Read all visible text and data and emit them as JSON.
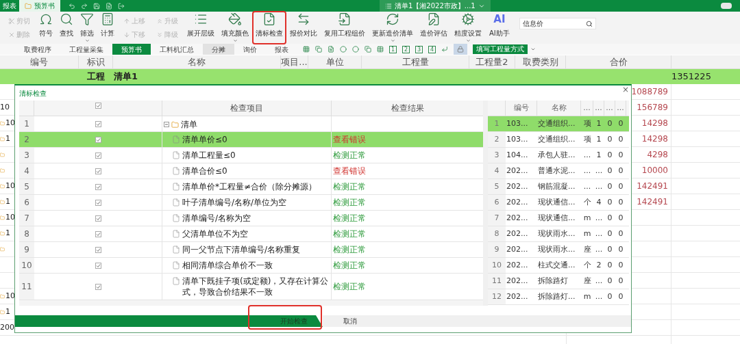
{
  "title_bar": {
    "tabs": [
      {
        "label": "报表",
        "selected": false
      },
      {
        "label": "预算书",
        "selected": true
      }
    ],
    "document": "清单1【湘2022市政】...1"
  },
  "toolbar": [
    {
      "kind": "stack",
      "items": [
        {
          "label": "剪切",
          "disabled": true
        },
        {
          "label": "删除",
          "disabled": true
        }
      ]
    },
    {
      "kind": "large",
      "label": "符号",
      "caret": false,
      "highlighted": false
    },
    {
      "kind": "large",
      "label": "查找",
      "caret": false,
      "highlighted": false
    },
    {
      "kind": "large",
      "label": "筛选",
      "caret": true,
      "highlighted": false
    },
    {
      "kind": "large",
      "label": "计算",
      "caret": false,
      "highlighted": false
    },
    {
      "kind": "stack",
      "items": [
        {
          "label": "上移",
          "disabled": true
        },
        {
          "label": "下移",
          "disabled": true
        }
      ]
    },
    {
      "kind": "stack",
      "items": [
        {
          "label": "升级",
          "disabled": true
        },
        {
          "label": "降级",
          "disabled": true
        }
      ]
    },
    {
      "kind": "large",
      "label": "展开层级",
      "caret": false,
      "highlighted": false
    },
    {
      "kind": "large",
      "label": "填充颜色",
      "caret": true,
      "highlighted": false
    },
    {
      "kind": "large",
      "label": "清标检查",
      "caret": false,
      "highlighted": true
    },
    {
      "kind": "large",
      "label": "报价对比",
      "caret": false,
      "highlighted": false
    },
    {
      "kind": "large",
      "label": "复用工程组价",
      "caret": false,
      "highlighted": false
    },
    {
      "kind": "large",
      "label": "更新造价清单",
      "caret": true,
      "highlighted": false
    },
    {
      "kind": "large",
      "label": "造价评估",
      "caret": false,
      "highlighted": false
    },
    {
      "kind": "large",
      "label": "精度设置",
      "caret": true,
      "highlighted": false
    },
    {
      "kind": "ai",
      "badge": "AI",
      "label": "AI助手"
    }
  ],
  "search": {
    "value": "信息价"
  },
  "view_tabs": [
    {
      "label": "取费程序",
      "selected": false,
      "hovered": false
    },
    {
      "label": "工程量采集",
      "selected": false,
      "hovered": false
    },
    {
      "label": "预算书",
      "selected": true,
      "hovered": false
    },
    {
      "label": "工料机汇总",
      "selected": false,
      "hovered": false
    },
    {
      "label": "分摊",
      "selected": false,
      "hovered": true
    },
    {
      "label": "询价",
      "selected": false,
      "hovered": false
    },
    {
      "label": "报表",
      "selected": false,
      "hovered": false
    }
  ],
  "level_buttons": [
    "1",
    "2",
    "3",
    "4"
  ],
  "mode_button": "填写工程量方式",
  "grid": {
    "columns": [
      "编号",
      "标识",
      "名称",
      "项目...",
      "单位",
      "工程量",
      "工程量2",
      "取费类别",
      "合价"
    ],
    "top_row": {
      "type": "工程",
      "name": "清单1",
      "total": "1351225"
    },
    "left_stubs": [
      {
        "folder": false
      },
      {
        "text": "10",
        "folder": false
      },
      {
        "text": "10",
        "folder": true
      },
      {
        "text": "1",
        "folder": true
      },
      {
        "folder": true
      },
      {
        "folder": true
      },
      {
        "text": "10",
        "folder": true
      },
      {
        "text": "1",
        "folder": true
      },
      {
        "text": "10",
        "folder": true
      },
      {
        "text": "1",
        "folder": true
      },
      {
        "folder": true
      },
      {
        "folder": false
      },
      {
        "folder": false
      },
      {
        "text": "10",
        "folder": true
      },
      {
        "text": "1",
        "folder": true
      },
      {
        "text": "200",
        "folder": false
      }
    ],
    "totals": [
      "1088789",
      "156789",
      "14298",
      "14298",
      "4298",
      "10000",
      "142491",
      "142491"
    ]
  },
  "dialog": {
    "title": "清标检查",
    "close": "×",
    "columns": [
      "检查项目",
      "检查结果"
    ],
    "header_checked": true,
    "checks": [
      {
        "num": "1",
        "checked": true,
        "label": "清单",
        "expanded": true,
        "selected": false,
        "children": [
          {
            "num": "2",
            "checked": true,
            "label": "清单单价≤0",
            "kind": "error",
            "result": "查看错误",
            "selected": true
          },
          {
            "num": "3",
            "checked": true,
            "label": "清单工程量≤0",
            "kind": "ok",
            "result": "检测正常",
            "selected": false
          },
          {
            "num": "4",
            "checked": true,
            "label": "清单合价≤0",
            "kind": "error",
            "result": "查看错误",
            "selected": false
          },
          {
            "num": "5",
            "checked": true,
            "label": "清单单价*工程量≠合价（除分摊源）",
            "kind": "ok",
            "result": "检测正常",
            "selected": false
          },
          {
            "num": "6",
            "checked": true,
            "label": "叶子清单编号/名称/单位为空",
            "kind": "ok",
            "result": "检测正常",
            "selected": false
          },
          {
            "num": "7",
            "checked": true,
            "label": "清单编号/名称为空",
            "kind": "ok",
            "result": "检测正常",
            "selected": false
          },
          {
            "num": "8",
            "checked": true,
            "label": "父清单单位不为空",
            "kind": "ok",
            "result": "检测正常",
            "selected": false
          },
          {
            "num": "9",
            "checked": true,
            "label": "同一父节点下清单编号/名称重复",
            "kind": "ok",
            "result": "检测正常",
            "selected": false
          },
          {
            "num": "10",
            "checked": true,
            "label": "相同清单综合单价不一致",
            "kind": "ok",
            "result": "检测正常",
            "selected": false
          },
          {
            "num": "11",
            "checked": true,
            "label": "清单下既挂子项(或定额)，又存在计算公式，导致合价结果不一致",
            "kind": "ok",
            "result": "检测正常",
            "selected": false
          }
        ]
      }
    ],
    "detail": {
      "columns": [
        "编号",
        "名称",
        "...",
        "...",
        "...",
        "..."
      ],
      "rows": [
        {
          "num": "1",
          "cells": [
            "103...",
            "交通组织...",
            "项",
            "1",
            "0",
            "0"
          ],
          "selected": true
        },
        {
          "num": "2",
          "cells": [
            "103...",
            "交通组织...",
            "项",
            "1",
            "0",
            "0"
          ],
          "selected": false
        },
        {
          "num": "3",
          "cells": [
            "104...",
            "承包人驻...",
            "...",
            "1",
            "0",
            "0"
          ],
          "selected": false
        },
        {
          "num": "4",
          "cells": [
            "202...",
            "普通水泥...",
            "...",
            "...",
            "0",
            "0"
          ],
          "selected": false
        },
        {
          "num": "5",
          "cells": [
            "202...",
            "钢筋混凝...",
            "...",
            "...",
            "0",
            "0"
          ],
          "selected": false
        },
        {
          "num": "6",
          "cells": [
            "202...",
            "现状通信...",
            "个",
            "4",
            "0",
            "0"
          ],
          "selected": false
        },
        {
          "num": "7",
          "cells": [
            "202...",
            "现状通信...",
            "m",
            "...",
            "0",
            "0"
          ],
          "selected": false
        },
        {
          "num": "8",
          "cells": [
            "202...",
            "现状雨水...",
            "m",
            "...",
            "0",
            "0"
          ],
          "selected": false
        },
        {
          "num": "9",
          "cells": [
            "202...",
            "现状雨水...",
            "座",
            "...",
            "0",
            "0"
          ],
          "selected": false
        },
        {
          "num": "10",
          "cells": [
            "202...",
            "柱式交通...",
            "个",
            "2",
            "0",
            "0"
          ],
          "selected": false
        },
        {
          "num": "11",
          "cells": [
            "202...",
            "拆除路灯",
            "座",
            "...",
            "0",
            "0"
          ],
          "selected": false
        },
        {
          "num": "12",
          "cells": [
            "202...",
            "拆除路灯...",
            "m",
            "...",
            "0",
            "0"
          ],
          "selected": false
        }
      ]
    },
    "start_button": {
      "label": "开始检查",
      "highlighted": true
    },
    "cancel_button": "取消"
  }
}
